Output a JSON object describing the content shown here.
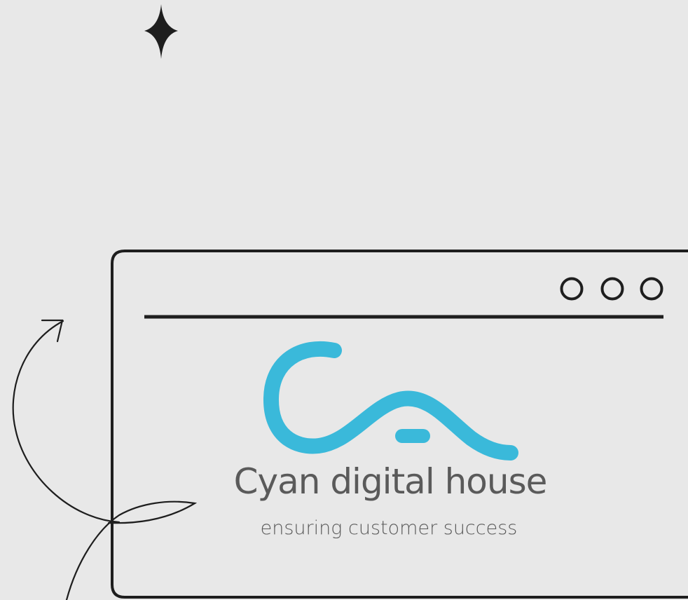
{
  "brand": {
    "name": "Cyan digital house",
    "tagline": "ensuring customer success"
  },
  "window_controls": [
    "circle-icon",
    "circle-icon",
    "circle-icon"
  ],
  "colors": {
    "background": "#e8e8e8",
    "line": "#1e1e1e",
    "logo": "#3ab9da",
    "text": "#5a5a5a"
  }
}
